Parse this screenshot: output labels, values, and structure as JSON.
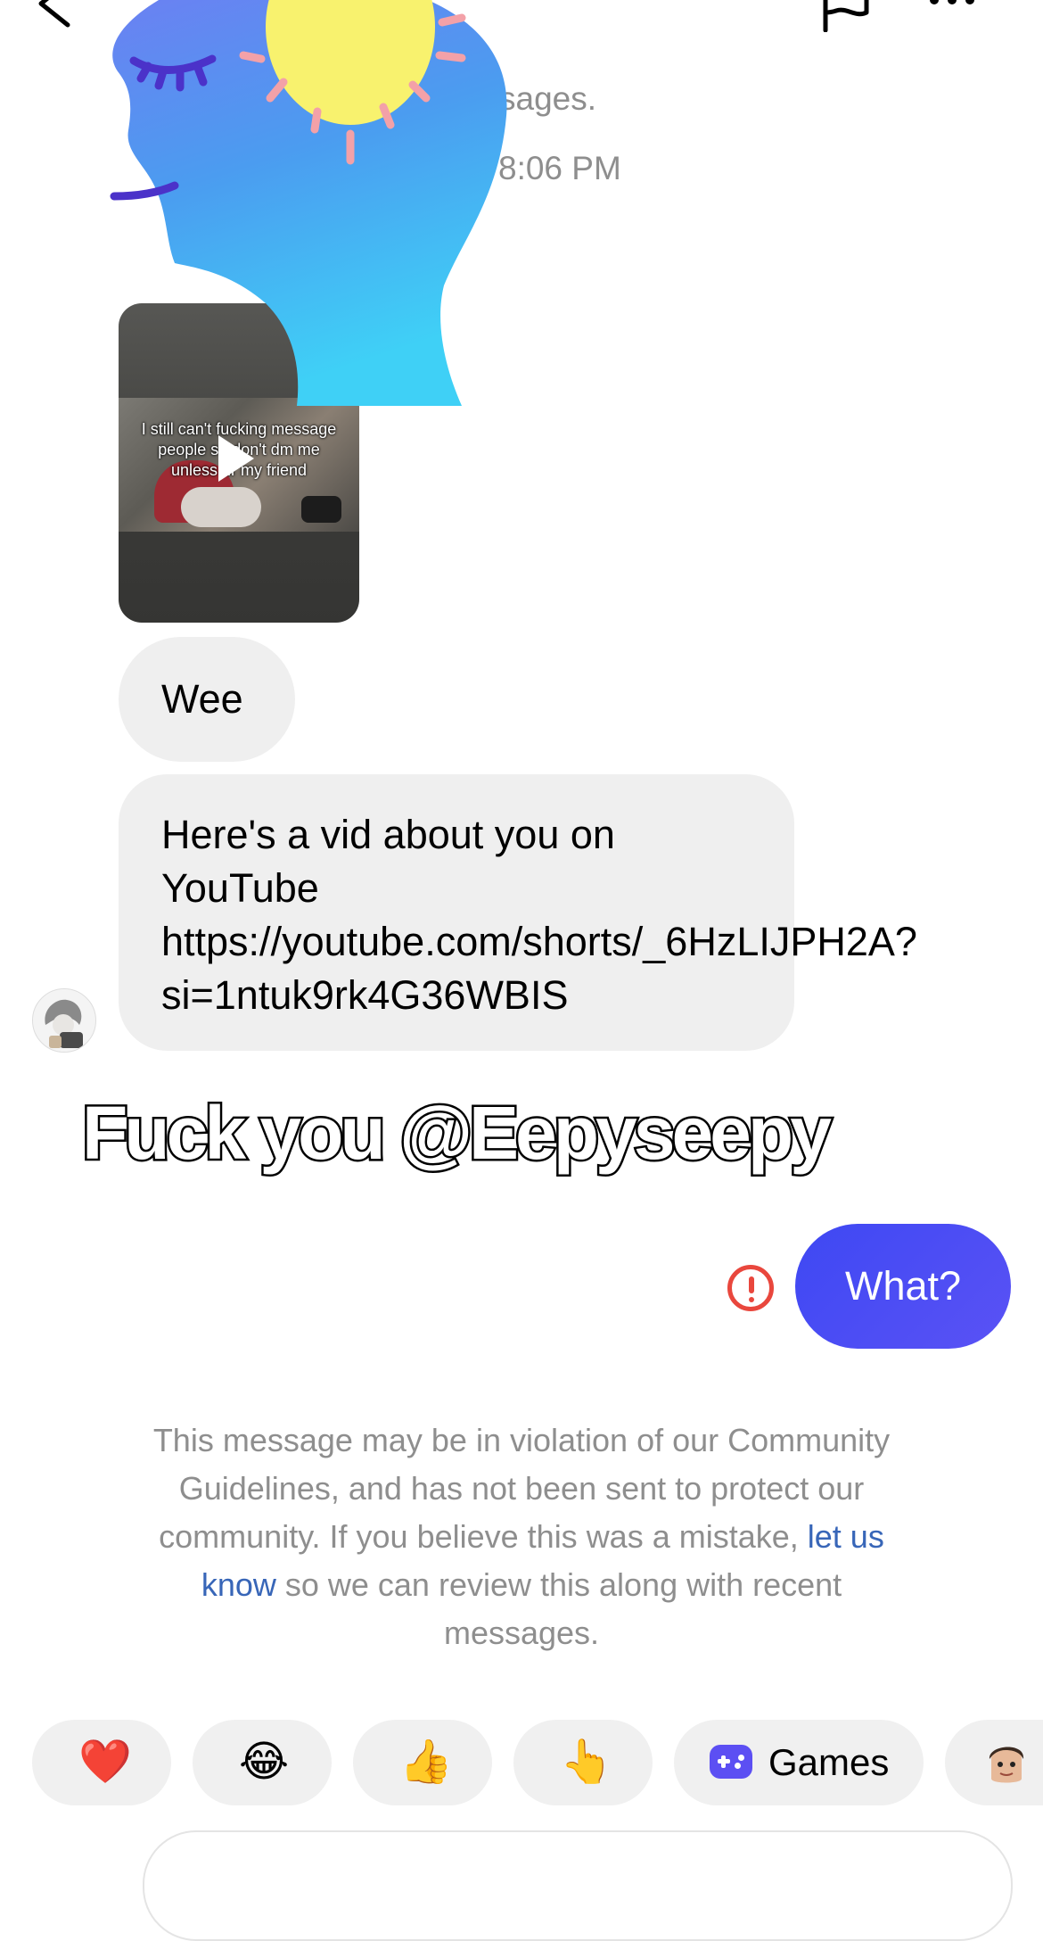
{
  "system": {
    "line1": "sages.",
    "line2": "ly 8:06 PM"
  },
  "video": {
    "caption": "I still can't fucking message people so don't dm me unless ur my friend"
  },
  "messages": {
    "incoming": [
      {
        "text": "Wee"
      },
      {
        "text": "Here's a vid about you on YouTube https://youtube.com/shorts/_6HzLIJPH2A?si=1ntuk9rk4G36WBIS"
      }
    ],
    "outgoing": [
      {
        "text": "What?",
        "status": "not-sent"
      }
    ]
  },
  "overlay": {
    "caption": "Fuck you @Eepyseepy"
  },
  "notice": {
    "before": "This message may be in violation of our Community Guidelines, and has not been sent to protect our community. If you believe this was a mistake, ",
    "link": "let us know",
    "after": " so we can review this along with recent messages."
  },
  "quick_replies": [
    {
      "icon": "heart-icon",
      "emoji": "❤️"
    },
    {
      "icon": "laughing-face-icon",
      "emoji": "😂"
    },
    {
      "icon": "thumbs-up-icon",
      "emoji": "👍"
    },
    {
      "icon": "pointing-hand-icon",
      "emoji": "👆"
    },
    {
      "icon": "gamepad-icon",
      "label": "Games"
    },
    {
      "icon": "avatar-sticker-icon"
    }
  ],
  "colors": {
    "outgoing_bubble": "#4a4ef4",
    "incoming_bubble": "#efefef",
    "error": "#e9473d",
    "link": "#3866b8",
    "system_text": "#8e8e8e"
  }
}
